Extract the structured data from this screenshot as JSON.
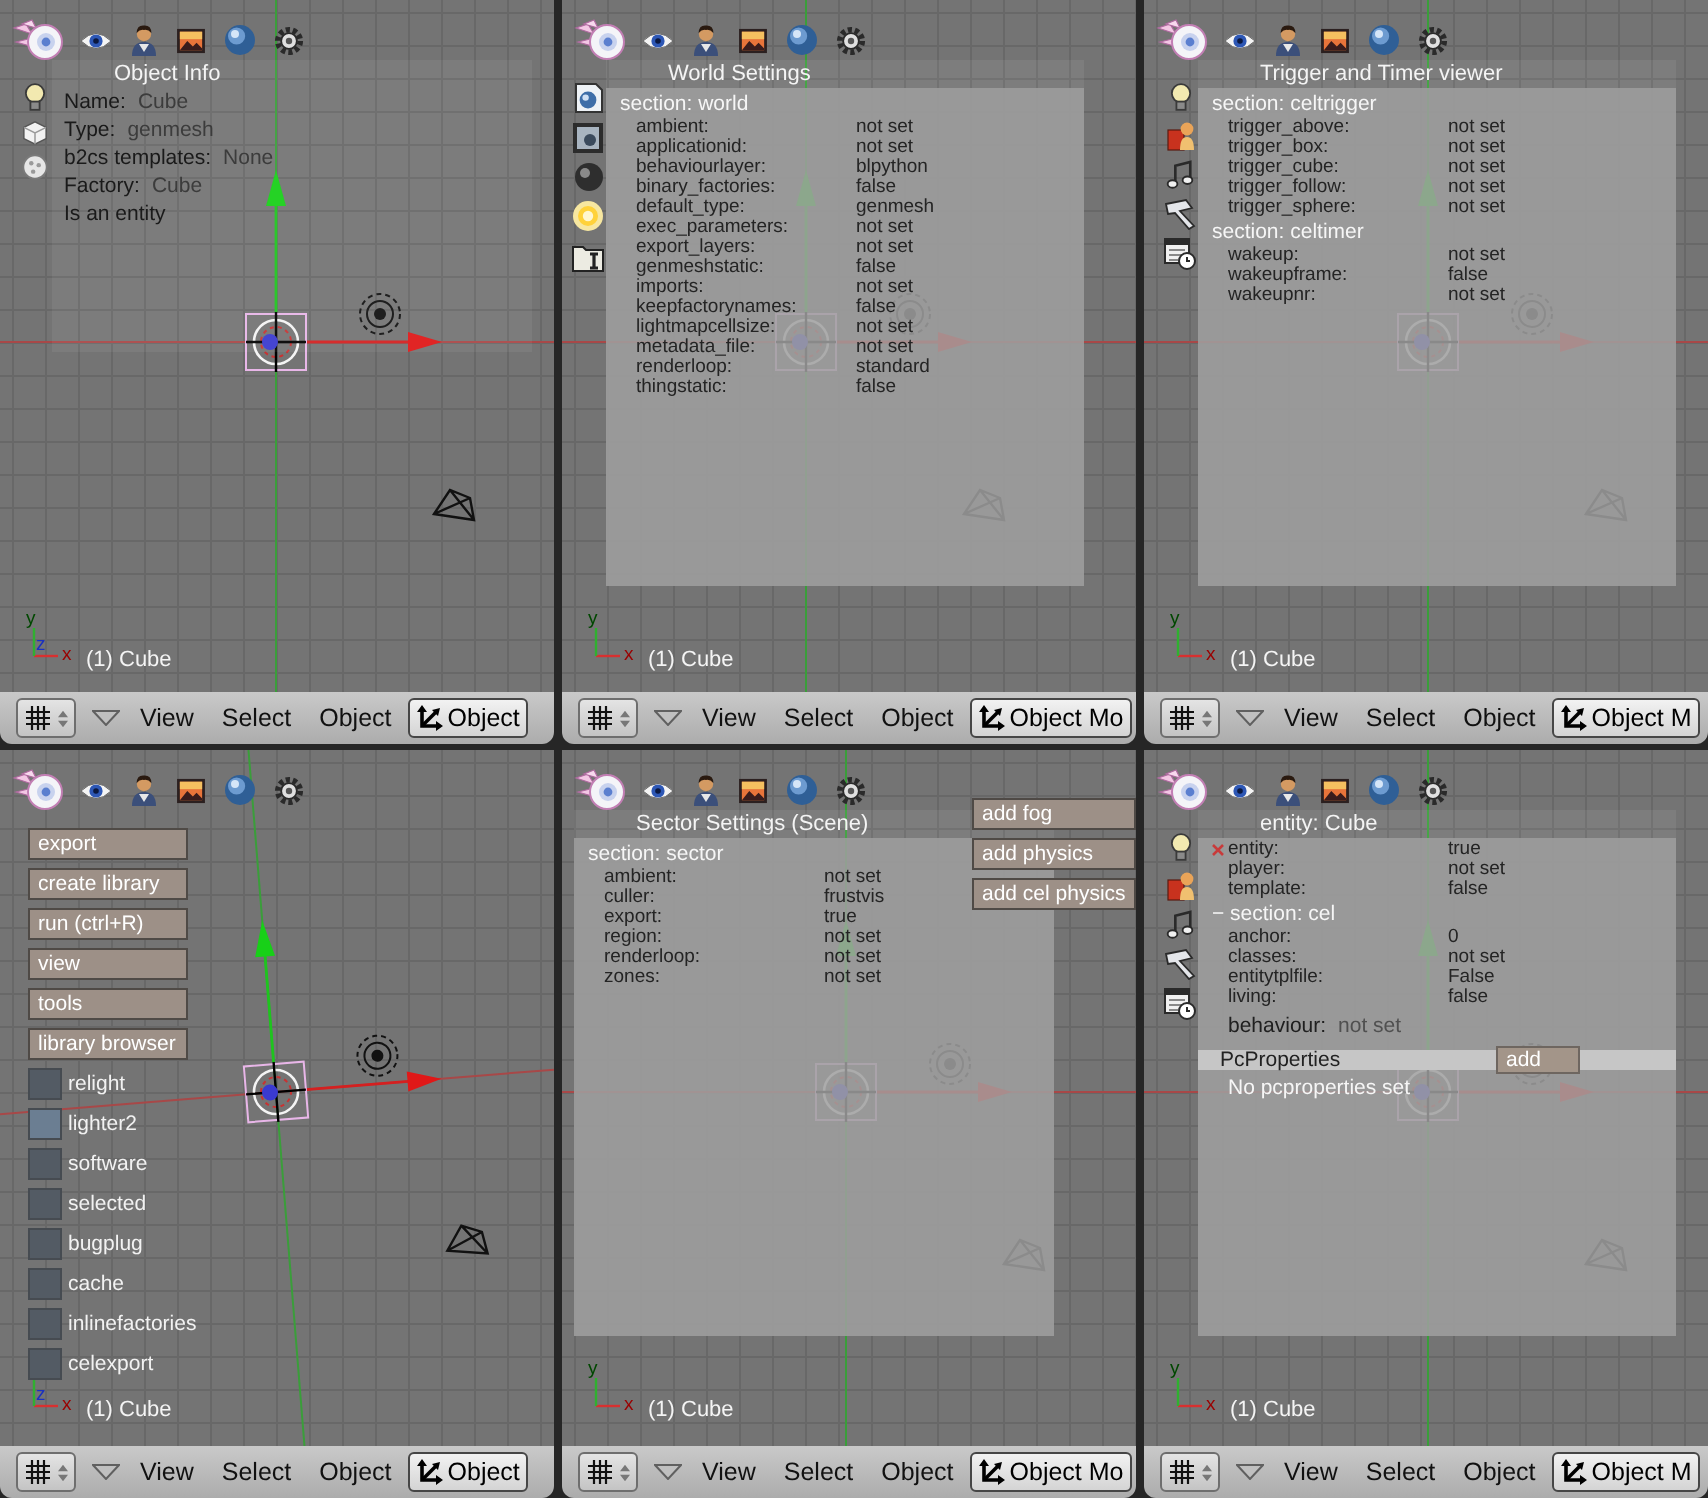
{
  "viewports": [
    {
      "kind": "object_info",
      "panel": {
        "title": "Object Info",
        "fields": [
          {
            "label": "Name:",
            "value": "Cube"
          },
          {
            "label": "Type:",
            "value": "genmesh"
          },
          {
            "label": "b2cs templates:",
            "value": "None"
          },
          {
            "label": "Factory:",
            "value": "Cube"
          }
        ],
        "note": "Is an entity"
      },
      "gizmo": {
        "x": "x",
        "y": "y",
        "z": "z"
      },
      "object_label": "(1) Cube",
      "header": {
        "menus": [
          "View",
          "Select",
          "Object"
        ],
        "mode": "Object"
      }
    },
    {
      "kind": "world_settings",
      "panel": {
        "title": "World Settings",
        "items": [
          {
            "kind": "section",
            "text": "section: world"
          },
          {
            "kind": "row",
            "label": "ambient:",
            "value": "not set"
          },
          {
            "kind": "row",
            "label": "applicationid:",
            "value": "not set"
          },
          {
            "kind": "row",
            "label": "behaviourlayer:",
            "value": "blpython"
          },
          {
            "kind": "row",
            "label": "binary_factories:",
            "value": "false"
          },
          {
            "kind": "row",
            "label": "default_type:",
            "value": "genmesh"
          },
          {
            "kind": "row",
            "label": "exec_parameters:",
            "value": "not set"
          },
          {
            "kind": "row",
            "label": "export_layers:",
            "value": "not set"
          },
          {
            "kind": "row",
            "label": "genmeshstatic:",
            "value": "false"
          },
          {
            "kind": "row",
            "label": "imports:",
            "value": "not set"
          },
          {
            "kind": "row",
            "label": "keepfactorynames:",
            "value": "false"
          },
          {
            "kind": "row",
            "label": "lightmapcellsize:",
            "value": "not set"
          },
          {
            "kind": "row",
            "label": "metadata_file:",
            "value": "not set"
          },
          {
            "kind": "row",
            "label": "renderloop:",
            "value": "standard"
          },
          {
            "kind": "row",
            "label": "thingstatic:",
            "value": "false"
          }
        ]
      },
      "gizmo": {
        "x": "x",
        "y": "y"
      },
      "object_label": "(1) Cube",
      "header": {
        "menus": [
          "View",
          "Select",
          "Object"
        ],
        "mode": "Object Mo"
      }
    },
    {
      "kind": "trigger_viewer",
      "panel": {
        "title": "Trigger and Timer viewer",
        "items": [
          {
            "kind": "section",
            "text": "section: celtrigger"
          },
          {
            "kind": "row",
            "label": "trigger_above:",
            "value": "not set"
          },
          {
            "kind": "row",
            "label": "trigger_box:",
            "value": "not set"
          },
          {
            "kind": "row",
            "label": "trigger_cube:",
            "value": "not set"
          },
          {
            "kind": "row",
            "label": "trigger_follow:",
            "value": "not set"
          },
          {
            "kind": "row",
            "label": "trigger_sphere:",
            "value": "not set"
          },
          {
            "kind": "section",
            "text": "section: celtimer"
          },
          {
            "kind": "row",
            "label": "wakeup:",
            "value": "not set"
          },
          {
            "kind": "row",
            "label": "wakeupframe:",
            "value": "false"
          },
          {
            "kind": "row",
            "label": "wakeupnr:",
            "value": "not set"
          }
        ]
      },
      "gizmo": {
        "x": "x",
        "y": "y"
      },
      "object_label": "(1) Cube",
      "header": {
        "menus": [
          "View",
          "Select",
          "Object"
        ],
        "mode": "Object M"
      }
    },
    {
      "kind": "script_buttons",
      "buttons": [
        "export",
        "create library",
        "run (ctrl+R)",
        "view",
        "tools",
        "library browser"
      ],
      "toggles": [
        {
          "label": "relight",
          "on": false
        },
        {
          "label": "lighter2",
          "on": true
        },
        {
          "label": "software",
          "on": false
        },
        {
          "label": "selected",
          "on": false
        },
        {
          "label": "bugplug",
          "on": false
        },
        {
          "label": "cache",
          "on": false
        },
        {
          "label": "inlinefactories",
          "on": false
        },
        {
          "label": "celexport",
          "on": false
        }
      ],
      "gizmo": {
        "x": "x",
        "z": "z"
      },
      "object_label": "(1) Cube",
      "header": {
        "menus": [
          "View",
          "Select",
          "Object"
        ],
        "mode": "Object"
      }
    },
    {
      "kind": "sector_settings",
      "panel": {
        "title": "Sector Settings (Scene)",
        "items": [
          {
            "kind": "section",
            "text": "section: sector"
          },
          {
            "kind": "row",
            "label": "ambient:",
            "value": "not set"
          },
          {
            "kind": "row",
            "label": "culler:",
            "value": "frustvis"
          },
          {
            "kind": "row",
            "label": "export:",
            "value": "true"
          },
          {
            "kind": "row",
            "label": "region:",
            "value": "not set"
          },
          {
            "kind": "row",
            "label": "renderloop:",
            "value": "not set"
          },
          {
            "kind": "row",
            "label": "zones:",
            "value": "not set"
          }
        ]
      },
      "buttons": [
        "add fog",
        "add physics",
        "add cel physics"
      ],
      "gizmo": {
        "x": "x",
        "y": "y"
      },
      "object_label": "(1) Cube",
      "header": {
        "menus": [
          "View",
          "Select",
          "Object"
        ],
        "mode": "Object Mo"
      }
    },
    {
      "kind": "entity_viewer",
      "panel": {
        "title": "entity: Cube",
        "items": [
          {
            "kind": "marked_row",
            "label": "entity:",
            "value": "true"
          },
          {
            "kind": "row",
            "label": "player:",
            "value": "not set"
          },
          {
            "kind": "row",
            "label": "template:",
            "value": "false"
          },
          {
            "kind": "section",
            "text": "− section: cel"
          },
          {
            "kind": "row",
            "label": "anchor:",
            "value": "0"
          },
          {
            "kind": "row",
            "label": "classes:",
            "value": "not set"
          },
          {
            "kind": "row",
            "label": "entitytplfile:",
            "value": "False"
          },
          {
            "kind": "row",
            "label": "living:",
            "value": "false"
          },
          {
            "kind": "inline_row",
            "label": "behaviour:",
            "value": "not set"
          },
          {
            "kind": "bar",
            "text": "PcProperties",
            "button": "add"
          },
          {
            "kind": "note",
            "text": "No pcproperties set"
          }
        ]
      },
      "gizmo": {
        "x": "x",
        "y": "y"
      },
      "object_label": "(1) Cube",
      "header": {
        "menus": [
          "View",
          "Select",
          "Object"
        ],
        "mode": "Object M"
      }
    }
  ]
}
